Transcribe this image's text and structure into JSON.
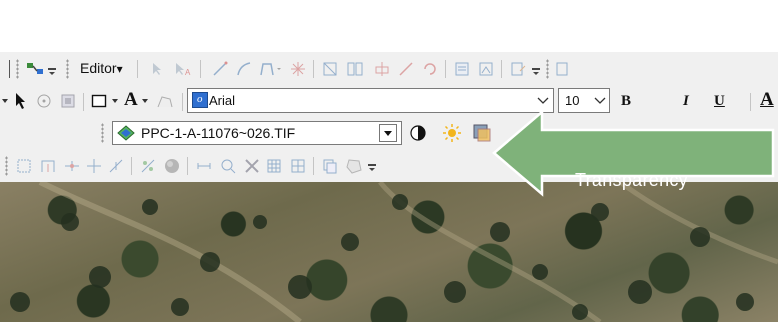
{
  "toolbar1": {
    "editor_label": "Editor",
    "dropdown_arrow": "▾"
  },
  "toolbar2": {
    "font_name": "Arial",
    "font_size": "10",
    "bold": "B",
    "italic": "I",
    "underline": "U",
    "text_color_letter": "A",
    "text_label": "A"
  },
  "effects_toolbar": {
    "layer_name": "PPC-1-A-11076~026.TIF"
  },
  "callout": {
    "text": "Transparency",
    "color": "#7fb27a",
    "border": "#ffffff"
  },
  "colors": {
    "toolbar_bg": "#f0f0f0",
    "combo_border": "#7a7a7a",
    "accent_blue": "#2f6fd0"
  }
}
